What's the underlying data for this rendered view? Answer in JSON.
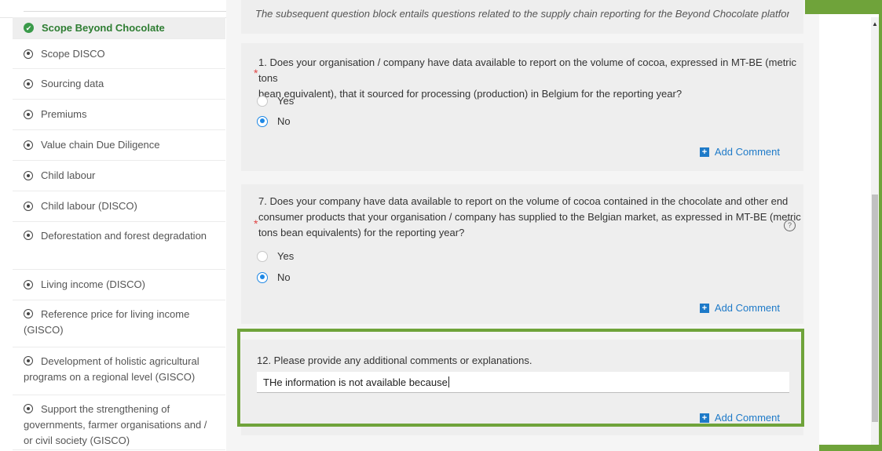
{
  "header": {
    "intro_text": "The subsequent question block entails questions related to the supply chain reporting for the Beyond Chocolate platform."
  },
  "sidebar": {
    "items": [
      {
        "label": "Scope Beyond Chocolate",
        "active": true
      },
      {
        "label": "Scope DISCO"
      },
      {
        "label": "Sourcing data"
      },
      {
        "label": "Premiums"
      },
      {
        "label": "Value chain Due Diligence"
      },
      {
        "label": "Child labour"
      },
      {
        "label": "Child labour (DISCO)"
      },
      {
        "label": "Deforestation and forest degradation"
      },
      {
        "label": "Living income (DISCO)"
      },
      {
        "label": "Reference price for living income (GISCO)"
      },
      {
        "label": "Development of holistic agricultural programs on a regional level (GISCO)"
      },
      {
        "label": "Support the strengthening of governments, farmer organisations and / or civil society (GISCO)"
      }
    ]
  },
  "questions": [
    {
      "line1": "1. Does your organisation / company have data available to report on the volume of cocoa, expressed in MT-BE (metric tons",
      "line2": "bean equivalent), that it sourced for processing (production) in Belgium for the reporting year?",
      "required_mark": "*",
      "options": [
        "Yes",
        "No"
      ],
      "selected": "No",
      "add_comment": "Add Comment"
    },
    {
      "line1": "7. Does your company have data available to report on the volume of cocoa contained in the chocolate and other end",
      "line2": "consumer products that your organisation / company has supplied to the Belgian market, as expressed in MT-BE (metric",
      "line3": "tons bean equivalents) for the reporting year?",
      "required_mark": "*",
      "options": [
        "Yes",
        "No"
      ],
      "selected": "No",
      "help_icon": "?",
      "add_comment": "Add Comment"
    },
    {
      "label": "12. Please provide any additional comments or explanations.",
      "value": "THe information is not available because",
      "add_comment": "Add Comment"
    }
  ],
  "icons": {
    "check": "✔",
    "plus": "+"
  },
  "colors": {
    "accent_green": "#6fa33a",
    "link_blue": "#1e7ac8",
    "required_red": "#e04444"
  }
}
